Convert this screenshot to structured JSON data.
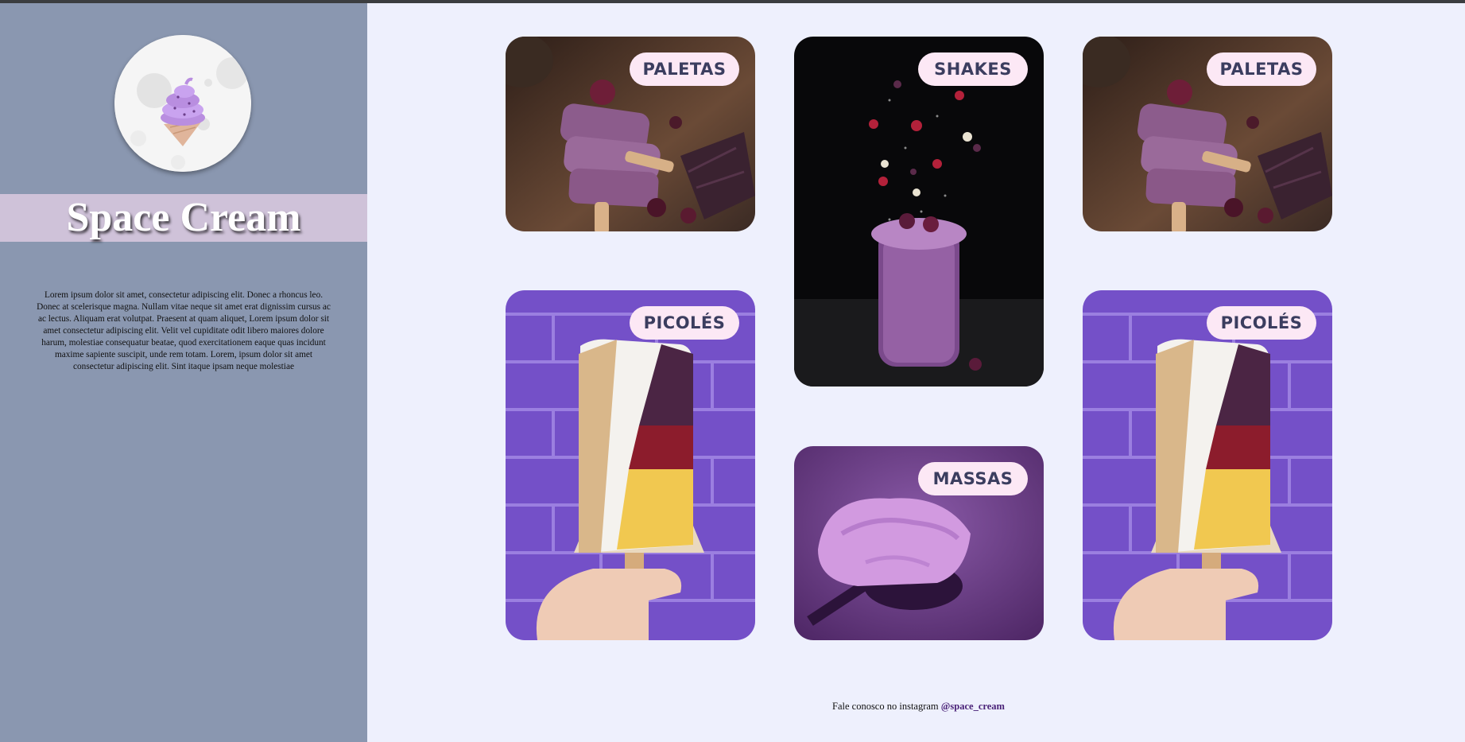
{
  "brand": {
    "name": "Space Cream",
    "description": "Lorem ipsum dolor sit amet, consectetur adipiscing elit. Donec a rhoncus leo. Donec at scelerisque magna. Nullam vitae neque sit amet erat dignissim cursus ac ac lectus. Aliquam erat volutpat. Praesent at quam aliquet, Lorem ipsum dolor sit amet consectetur adipiscing elit. Velit vel cupiditate odit libero maiores dolore harum, molestiae consequatur beatae, quod exercitationem eaque quas incidunt maxime sapiente suscipit, unde rem totam. Lorem, ipsum dolor sit amet consectetur adipiscing elit. Sint itaque ipsam neque molestiae"
  },
  "categories": [
    {
      "label": "PALETAS",
      "image": "stacked-purple-popsicles"
    },
    {
      "label": "SHAKES",
      "image": "purple-shake-jar"
    },
    {
      "label": "PALETAS",
      "image": "stacked-purple-popsicles"
    },
    {
      "label": "PICOLÉS",
      "image": "popsicle-brick-wall"
    },
    {
      "label": "MASSAS",
      "image": "ice-cream-scoop"
    },
    {
      "label": "PICOLÉS",
      "image": "popsicle-brick-wall"
    }
  ],
  "footer": {
    "text": "Fale conosco no instagram",
    "instagram_handle": "@space_cream"
  },
  "colors": {
    "sidebar": "#8a97b0",
    "title_band": "#cfc2d9",
    "page_background": "#eef0fd",
    "pill_background": "#fce8f5",
    "pill_text": "#3b3d5f",
    "link": "#4a2278"
  }
}
